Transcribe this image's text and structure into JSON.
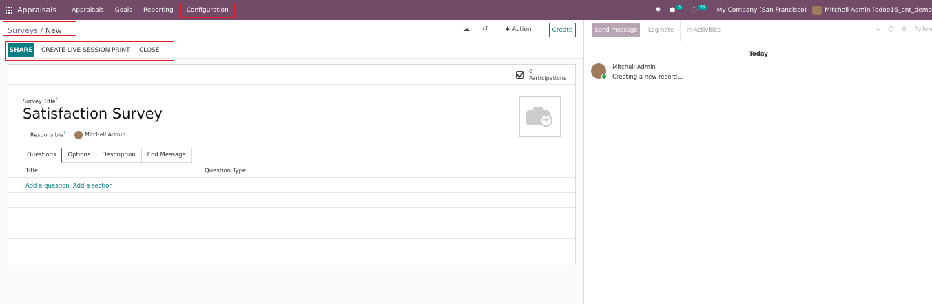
{
  "navbar": {
    "app_name": "Appraisals",
    "menu": [
      "Appraisals",
      "Goals",
      "Reporting",
      "Configuration"
    ],
    "bug_icon": "bug-icon",
    "chat_badge": "5",
    "activity_badge": "55",
    "company": "My Company (San Francisco)",
    "user": "Mitchell Admin (odoo16_ent_demo"
  },
  "breadcrumb": {
    "parent": "Surveys",
    "separator": "/",
    "current": "New"
  },
  "control": {
    "action_label": "✱ Action",
    "create_label": "Create"
  },
  "header_buttons": {
    "share": "SHARE",
    "live": "CREATE LIVE SESSION",
    "print": "PRINT",
    "close": "CLOSE"
  },
  "stat": {
    "count": "0",
    "label": "Participations"
  },
  "form": {
    "title_label": "Survey Title",
    "help_mark": "?",
    "title_value": "Satisfaction Survey",
    "responsible_label": "Responsible",
    "responsible_value": "Mitchell Admin"
  },
  "tabs": [
    "Questions",
    "Options",
    "Description",
    "End Message"
  ],
  "list": {
    "columns": [
      "Title",
      "Question Type"
    ],
    "add_question": "Add a question",
    "add_section": "Add a section"
  },
  "chatter": {
    "send_message": "Send message",
    "log_note": "Log note",
    "activities": "Activities",
    "attachments": "",
    "followers_count": "0",
    "follow": "Follow",
    "date_separator": "Today",
    "message": {
      "author": "Mitchell Admin",
      "body": "Creating a new record..."
    }
  }
}
